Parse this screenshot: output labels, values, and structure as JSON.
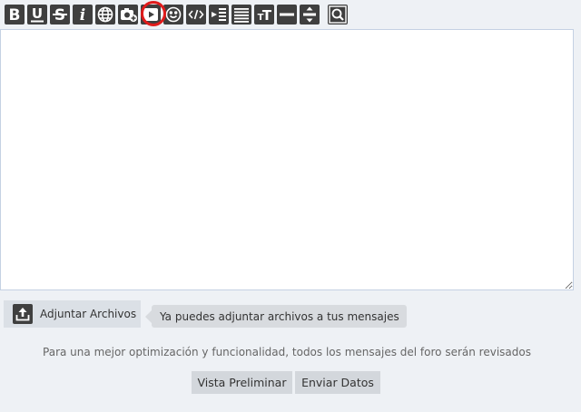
{
  "toolbar": {
    "buttons": [
      {
        "name": "bold-button",
        "icon": "bold-icon"
      },
      {
        "name": "underline-button",
        "icon": "underline-icon"
      },
      {
        "name": "strikethrough-button",
        "icon": "strikethrough-icon"
      },
      {
        "name": "italic-button",
        "icon": "italic-icon"
      },
      {
        "name": "insert-link-button",
        "icon": "globe-icon"
      },
      {
        "name": "insert-image-button",
        "icon": "camera-plus-icon"
      },
      {
        "name": "insert-video-button",
        "icon": "play-icon"
      },
      {
        "name": "insert-emoji-button",
        "icon": "smiley-icon"
      },
      {
        "name": "insert-code-button",
        "icon": "code-icon"
      },
      {
        "name": "indent-button",
        "icon": "indent-icon"
      },
      {
        "name": "align-button",
        "icon": "align-justify-icon"
      },
      {
        "name": "text-size-button",
        "icon": "text-size-icon"
      },
      {
        "name": "horizontal-rule-button",
        "icon": "horizontal-rule-icon"
      },
      {
        "name": "line-spacing-button",
        "icon": "line-spacing-icon"
      },
      {
        "name": "preview-zoom-button",
        "icon": "magnifier-icon"
      }
    ],
    "highlighted": "insert-video-button"
  },
  "editor": {
    "value": ""
  },
  "attach": {
    "label": "Adjuntar Archivos",
    "icon": "upload-icon"
  },
  "tip": {
    "text": "Ya puedes adjuntar archivos a tus mensajes"
  },
  "notice": {
    "text": "Para una mejor optimización y funcionalidad, todos los mensajes del foro serán revisados"
  },
  "actions": {
    "preview_label": "Vista Preliminar",
    "submit_label": "Enviar Datos"
  },
  "colors": {
    "icon_bg": "#3f3f3f",
    "highlight": "#e01b1b",
    "page_bg": "#eef1f5",
    "editor_border": "#c4d1e3"
  }
}
